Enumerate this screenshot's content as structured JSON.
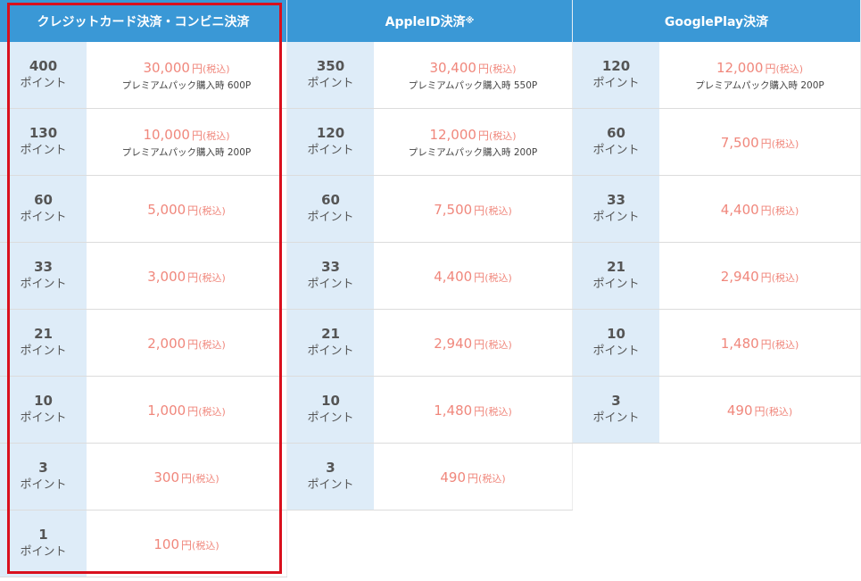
{
  "columns": [
    {
      "title": "クレジットカード決済・コンビニ決済",
      "title_mark": "",
      "rows": [
        {
          "points": "400",
          "unit": "ポイント",
          "price": "30,000",
          "yen": "円",
          "tax": "(税込)",
          "note": "プレミアムパック購入時 600P"
        },
        {
          "points": "130",
          "unit": "ポイント",
          "price": "10,000",
          "yen": "円",
          "tax": "(税込)",
          "note": "プレミアムパック購入時 200P"
        },
        {
          "points": "60",
          "unit": "ポイント",
          "price": "5,000",
          "yen": "円",
          "tax": "(税込)",
          "note": ""
        },
        {
          "points": "33",
          "unit": "ポイント",
          "price": "3,000",
          "yen": "円",
          "tax": "(税込)",
          "note": ""
        },
        {
          "points": "21",
          "unit": "ポイント",
          "price": "2,000",
          "yen": "円",
          "tax": "(税込)",
          "note": ""
        },
        {
          "points": "10",
          "unit": "ポイント",
          "price": "1,000",
          "yen": "円",
          "tax": "(税込)",
          "note": ""
        },
        {
          "points": "3",
          "unit": "ポイント",
          "price": "300",
          "yen": "円",
          "tax": "(税込)",
          "note": ""
        },
        {
          "points": "1",
          "unit": "ポイント",
          "price": "100",
          "yen": "円",
          "tax": "(税込)",
          "note": ""
        }
      ]
    },
    {
      "title": "AppleID決済",
      "title_mark": "※",
      "rows": [
        {
          "points": "350",
          "unit": "ポイント",
          "price": "30,400",
          "yen": "円",
          "tax": "(税込)",
          "note": "プレミアムパック購入時 550P"
        },
        {
          "points": "120",
          "unit": "ポイント",
          "price": "12,000",
          "yen": "円",
          "tax": "(税込)",
          "note": "プレミアムパック購入時 200P"
        },
        {
          "points": "60",
          "unit": "ポイント",
          "price": "7,500",
          "yen": "円",
          "tax": "(税込)",
          "note": ""
        },
        {
          "points": "33",
          "unit": "ポイント",
          "price": "4,400",
          "yen": "円",
          "tax": "(税込)",
          "note": ""
        },
        {
          "points": "21",
          "unit": "ポイント",
          "price": "2,940",
          "yen": "円",
          "tax": "(税込)",
          "note": ""
        },
        {
          "points": "10",
          "unit": "ポイント",
          "price": "1,480",
          "yen": "円",
          "tax": "(税込)",
          "note": ""
        },
        {
          "points": "3",
          "unit": "ポイント",
          "price": "490",
          "yen": "円",
          "tax": "(税込)",
          "note": ""
        }
      ]
    },
    {
      "title": "GooglePlay決済",
      "title_mark": "",
      "rows": [
        {
          "points": "120",
          "unit": "ポイント",
          "price": "12,000",
          "yen": "円",
          "tax": "(税込)",
          "note": "プレミアムパック購入時 200P"
        },
        {
          "points": "60",
          "unit": "ポイント",
          "price": "7,500",
          "yen": "円",
          "tax": "(税込)",
          "note": ""
        },
        {
          "points": "33",
          "unit": "ポイント",
          "price": "4,400",
          "yen": "円",
          "tax": "(税込)",
          "note": ""
        },
        {
          "points": "21",
          "unit": "ポイント",
          "price": "2,940",
          "yen": "円",
          "tax": "(税込)",
          "note": ""
        },
        {
          "points": "10",
          "unit": "ポイント",
          "price": "1,480",
          "yen": "円",
          "tax": "(税込)",
          "note": ""
        },
        {
          "points": "3",
          "unit": "ポイント",
          "price": "490",
          "yen": "円",
          "tax": "(税込)",
          "note": ""
        }
      ]
    }
  ],
  "colors": {
    "header_bg": "#3a98d6",
    "points_bg": "#deecf8",
    "price_text": "#f0877c",
    "highlight_border": "#d9101d"
  }
}
